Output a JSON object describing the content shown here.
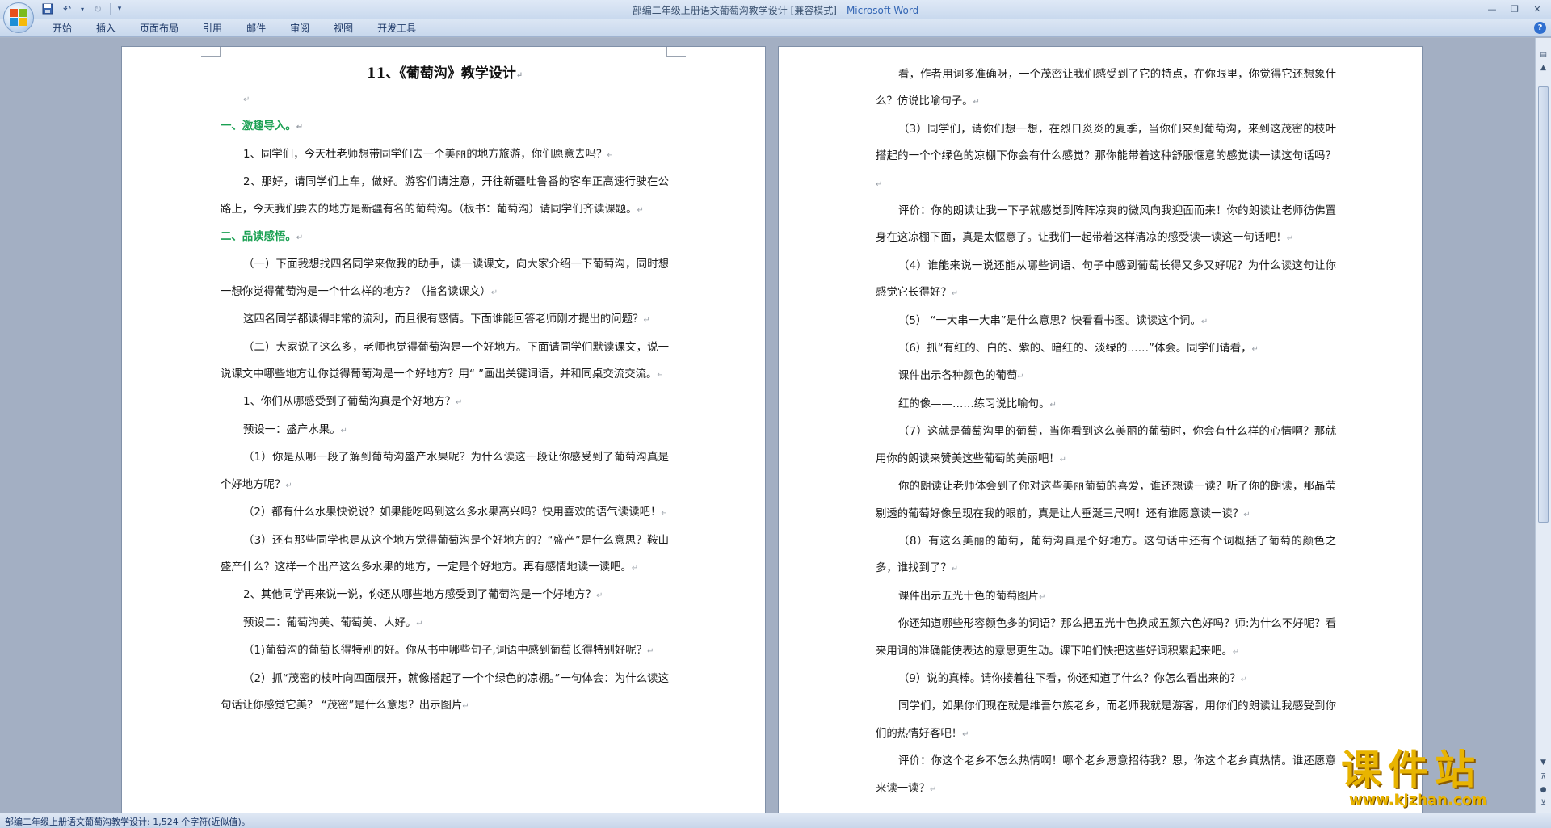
{
  "window": {
    "title": "部编二年级上册语文葡萄沟教学设计 [兼容模式]",
    "app_name": "Microsoft Word",
    "title_sep": " - "
  },
  "ribbon": {
    "tabs": [
      "开始",
      "插入",
      "页面布局",
      "引用",
      "邮件",
      "审阅",
      "视图",
      "开发工具"
    ]
  },
  "page_left": {
    "title": "11、《葡萄沟》教学设计",
    "paragraphs": [
      {
        "text": "",
        "style": "indent"
      },
      {
        "text": "一、激趣导入。",
        "style": "green"
      },
      {
        "text": "1、同学们，今天杜老师想带同学们去一个美丽的地方旅游，你们愿意去吗？",
        "style": "indent"
      },
      {
        "text": "2、那好，请同学们上车，做好。游客们请注意，开往新疆吐鲁番的客车正高速行驶在公路上，今天我们要去的地方是新疆有名的葡萄沟。（板书：葡萄沟）请同学们齐读课题。",
        "style": "indent"
      },
      {
        "text": "二、品读感悟。",
        "style": "green"
      },
      {
        "text": "（一）下面我想找四名同学来做我的助手，读一读课文，向大家介绍一下葡萄沟，同时想一想你觉得葡萄沟是一个什么样的地方？（指名读课文）",
        "style": "indent"
      },
      {
        "text": "这四名同学都读得非常的流利，而且很有感情。下面谁能回答老师刚才提出的问题？",
        "style": "indent"
      },
      {
        "text": "（二）大家说了这么多，老师也觉得葡萄沟是一个好地方。下面请同学们默读课文，说一说课文中哪些地方让你觉得葡萄沟是一个好地方？用“ ”画出关键词语，并和同桌交流交流。",
        "style": "indent"
      },
      {
        "text": "1、你们从哪感受到了葡萄沟真是个好地方？",
        "style": "indent"
      },
      {
        "text": "预设一：盛产水果。",
        "style": "indent"
      },
      {
        "text": "（1）你是从哪一段了解到葡萄沟盛产水果呢？为什么读这一段让你感受到了葡萄沟真是个好地方呢？",
        "style": "indent"
      },
      {
        "text": "（2）都有什么水果快说说？如果能吃吗到这么多水果高兴吗？快用喜欢的语气读读吧！",
        "style": "indent"
      },
      {
        "text": "（3）还有那些同学也是从这个地方觉得葡萄沟是个好地方的？“盛产”是什么意思？鞍山盛产什么？这样一个出产这么多水果的地方，一定是个好地方。再有感情地读一读吧。",
        "style": "indent"
      },
      {
        "text": "2、其他同学再来说一说，你还从哪些地方感受到了葡萄沟是一个好地方？",
        "style": "indent"
      },
      {
        "text": "预设二：葡萄沟美、葡萄美、人好。",
        "style": "indent"
      },
      {
        "text": "（1)葡萄沟的葡萄长得特别的好。你从书中哪些句子,词语中感到葡萄长得特别好呢？",
        "style": "indent"
      },
      {
        "text": "（2）抓“茂密的枝叶向四面展开，就像搭起了一个个绿色的凉棚。”一句体会：为什么读这句话让你感觉它美？ “茂密”是什么意思？出示图片",
        "style": "indent"
      }
    ]
  },
  "page_right": {
    "paragraphs": [
      {
        "text": "看，作者用词多准确呀，一个茂密让我们感受到了它的特点，在你眼里，你觉得它还想象什么？仿说比喻句子。",
        "style": "indent"
      },
      {
        "text": "（3）同学们，请你们想一想，在烈日炎炎的夏季，当你们来到葡萄沟，来到这茂密的枝叶搭起的一个个绿色的凉棚下你会有什么感觉？那你能带着这种舒服惬意的感觉读一读这句话吗？",
        "style": "indent"
      },
      {
        "text": "评价：你的朗读让我一下子就感觉到阵阵凉爽的微风向我迎面而来！你的朗读让老师彷佛置身在这凉棚下面，真是太惬意了。让我们一起带着这样清凉的感受读一读这一句话吧！",
        "style": "indent"
      },
      {
        "text": "（4）谁能来说一说还能从哪些词语、句子中感到葡萄长得又多又好呢？为什么读这句让你感觉它长得好？",
        "style": "indent"
      },
      {
        "text": "（5） “一大串一大串”是什么意思？快看看书图。读读这个词。",
        "style": "indent"
      },
      {
        "text": "（6）抓“有红的、白的、紫的、暗红的、淡绿的……”体会。同学们请看，",
        "style": "indent"
      },
      {
        "text": "课件出示各种颜色的葡萄",
        "style": "indent"
      },
      {
        "text": "红的像——……练习说比喻句。",
        "style": "indent"
      },
      {
        "text": "（7）这就是葡萄沟里的葡萄，当你看到这么美丽的葡萄时，你会有什么样的心情啊？那就用你的朗读来赞美这些葡萄的美丽吧！",
        "style": "indent"
      },
      {
        "text": "你的朗读让老师体会到了你对这些美丽葡萄的喜爱，谁还想读一读？听了你的朗读，那晶莹剔透的葡萄好像呈现在我的眼前，真是让人垂涎三尺啊！还有谁愿意读一读？",
        "style": "indent"
      },
      {
        "text": "（8）有这么美丽的葡萄，葡萄沟真是个好地方。这句话中还有个词概括了葡萄的颜色之多，谁找到了？",
        "style": "indent"
      },
      {
        "text": "课件出示五光十色的葡萄图片",
        "style": "indent"
      },
      {
        "text": "你还知道哪些形容颜色多的词语？那么把五光十色换成五颜六色好吗？师:为什么不好呢？看来用词的准确能使表达的意思更生动。课下咱们快把这些好词积累起来吧。",
        "style": "indent"
      },
      {
        "text": "（9）说的真棒。请你接着往下看，你还知道了什么？你怎么看出来的？",
        "style": "indent"
      },
      {
        "text": "同学们，如果你们现在就是维吾尔族老乡，而老师我就是游客，用你们的朗读让我感受到你们的热情好客吧！",
        "style": "indent"
      },
      {
        "text": "评价：你这个老乡不怎么热情啊！哪个老乡愿意招待我？恩，你这个老乡真热情。谁还愿意来读一读？",
        "style": "indent"
      }
    ]
  },
  "statusbar": {
    "text": "部编二年级上册语文葡萄沟教学设计: 1,524 个字符(近似值)。"
  },
  "watermark": {
    "cn": "课件站",
    "url": "www.kjzhan.com"
  }
}
